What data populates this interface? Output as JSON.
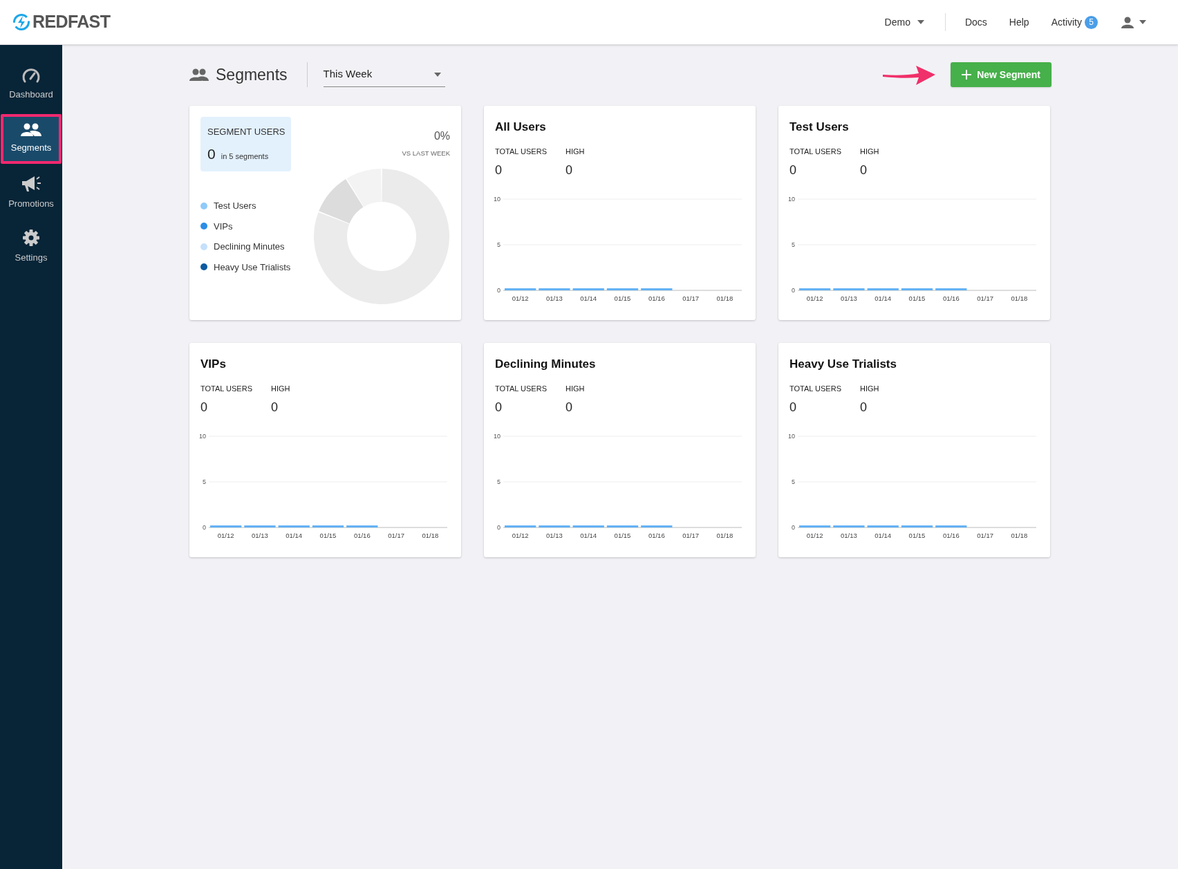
{
  "brand": {
    "name": "REDFAST"
  },
  "top_nav": [
    {
      "kind": "dropdown",
      "label": "Demo"
    },
    {
      "kind": "link",
      "label": "Docs"
    },
    {
      "kind": "link",
      "label": "Help"
    },
    {
      "kind": "badge",
      "label": "Activity",
      "badge": "5"
    },
    {
      "kind": "user"
    }
  ],
  "sidebar": {
    "items": [
      {
        "label": "Dashboard",
        "selected": false
      },
      {
        "label": "Segments",
        "selected": true
      },
      {
        "label": "Promotions",
        "selected": false
      },
      {
        "label": "Settings",
        "selected": false
      }
    ]
  },
  "page": {
    "title": "Segments",
    "period": {
      "value": "This Week"
    },
    "new_button": "New Segment"
  },
  "summary_card": {
    "heading": "SEGMENT USERS",
    "count": "0",
    "count_note": "in 5 segments",
    "change": "0%",
    "change_label": "VS LAST WEEK",
    "legend": [
      {
        "label": "Test Users",
        "color": "#90caf9"
      },
      {
        "label": "VIPs",
        "color": "#2b8de6"
      },
      {
        "label": "Declining Minutes",
        "color": "#c5e0fb"
      },
      {
        "label": "Heavy Use Trialists",
        "color": "#0d5aa0"
      }
    ]
  },
  "segment_cards": [
    {
      "title": "All Users",
      "stats": [
        {
          "label": "TOTAL USERS",
          "value": "0"
        },
        {
          "label": "HIGH",
          "value": "0"
        }
      ],
      "chart_data": {
        "type": "bar",
        "categories": [
          "01/12",
          "01/13",
          "01/14",
          "01/15",
          "01/16",
          "01/17",
          "01/18"
        ],
        "values": [
          0,
          0,
          0,
          0,
          0,
          null,
          null
        ],
        "ylim": [
          0,
          10
        ],
        "yticks": [
          0,
          5,
          10
        ]
      }
    },
    {
      "title": "Test Users",
      "stats": [
        {
          "label": "TOTAL USERS",
          "value": "0"
        },
        {
          "label": "HIGH",
          "value": "0"
        }
      ],
      "chart_data": {
        "type": "bar",
        "categories": [
          "01/12",
          "01/13",
          "01/14",
          "01/15",
          "01/16",
          "01/17",
          "01/18"
        ],
        "values": [
          0,
          0,
          0,
          0,
          0,
          null,
          null
        ],
        "ylim": [
          0,
          10
        ],
        "yticks": [
          0,
          5,
          10
        ]
      }
    },
    {
      "title": "VIPs",
      "stats": [
        {
          "label": "TOTAL USERS",
          "value": "0"
        },
        {
          "label": "HIGH",
          "value": "0"
        }
      ],
      "chart_data": {
        "type": "bar",
        "categories": [
          "01/12",
          "01/13",
          "01/14",
          "01/15",
          "01/16",
          "01/17",
          "01/18"
        ],
        "values": [
          0,
          0,
          0,
          0,
          0,
          null,
          null
        ],
        "ylim": [
          0,
          10
        ],
        "yticks": [
          0,
          5,
          10
        ]
      }
    },
    {
      "title": "Declining Minutes",
      "stats": [
        {
          "label": "TOTAL USERS",
          "value": "0"
        },
        {
          "label": "HIGH",
          "value": "0"
        }
      ],
      "chart_data": {
        "type": "bar",
        "categories": [
          "01/12",
          "01/13",
          "01/14",
          "01/15",
          "01/16",
          "01/17",
          "01/18"
        ],
        "values": [
          0,
          0,
          0,
          0,
          0,
          null,
          null
        ],
        "ylim": [
          0,
          10
        ],
        "yticks": [
          0,
          5,
          10
        ]
      }
    },
    {
      "title": "Heavy Use Trialists",
      "stats": [
        {
          "label": "TOTAL USERS",
          "value": "0"
        },
        {
          "label": "HIGH",
          "value": "0"
        }
      ],
      "chart_data": {
        "type": "bar",
        "categories": [
          "01/12",
          "01/13",
          "01/14",
          "01/15",
          "01/16",
          "01/17",
          "01/18"
        ],
        "values": [
          0,
          0,
          0,
          0,
          0,
          null,
          null
        ],
        "ylim": [
          0,
          10
        ],
        "yticks": [
          0,
          5,
          10
        ]
      }
    }
  ]
}
